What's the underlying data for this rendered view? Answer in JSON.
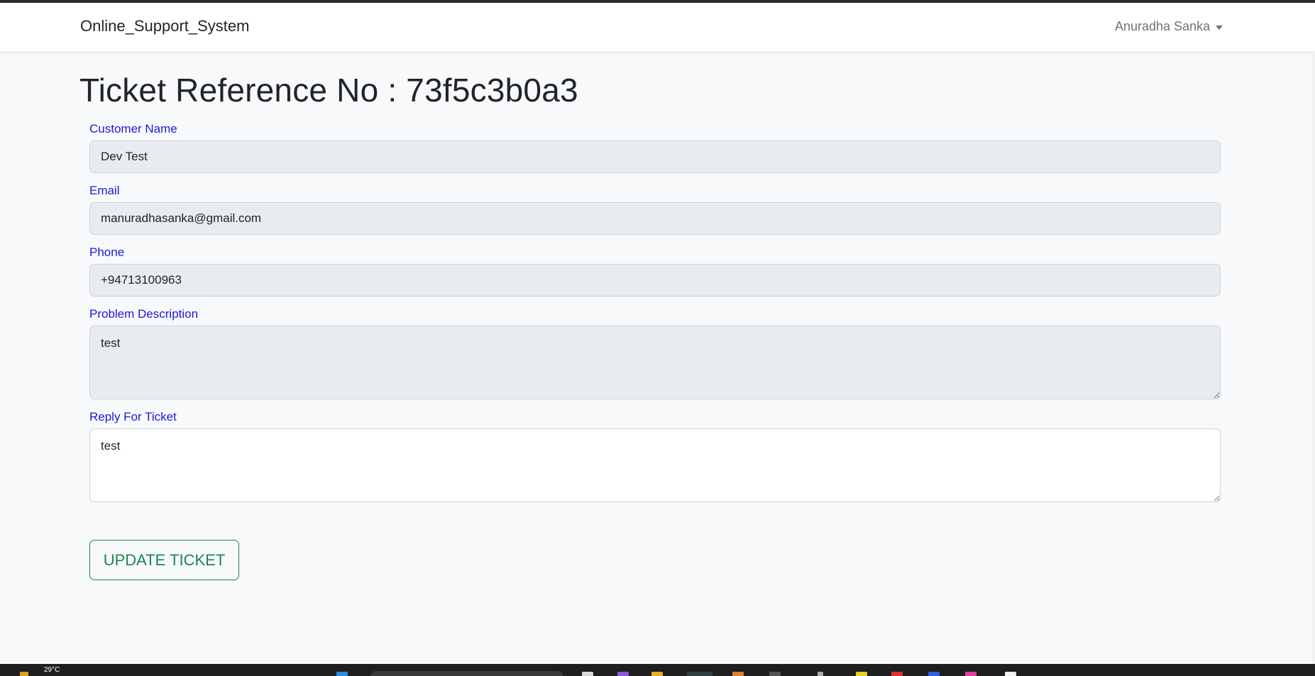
{
  "navbar": {
    "brand": "Online_Support_System",
    "user_name": "Anuradha Sanka"
  },
  "page": {
    "title": "Ticket Reference No : 73f5c3b0a3"
  },
  "form": {
    "customer_name": {
      "label": "Customer Name",
      "value": "Dev Test"
    },
    "email": {
      "label": "Email",
      "value": "manuradhasanka@gmail.com"
    },
    "phone": {
      "label": "Phone",
      "value": "+94713100963"
    },
    "problem_description": {
      "label": "Problem Description",
      "value": "test"
    },
    "reply": {
      "label": "Reply For Ticket",
      "value": "test"
    },
    "submit_label": "UPDATE TICKET"
  },
  "taskbar": {
    "weather": "29°C"
  },
  "colors": {
    "label": "#1a1adb",
    "success": "#198754",
    "readonly_bg": "#e9ecef",
    "page_bg": "#f8f9fa"
  }
}
